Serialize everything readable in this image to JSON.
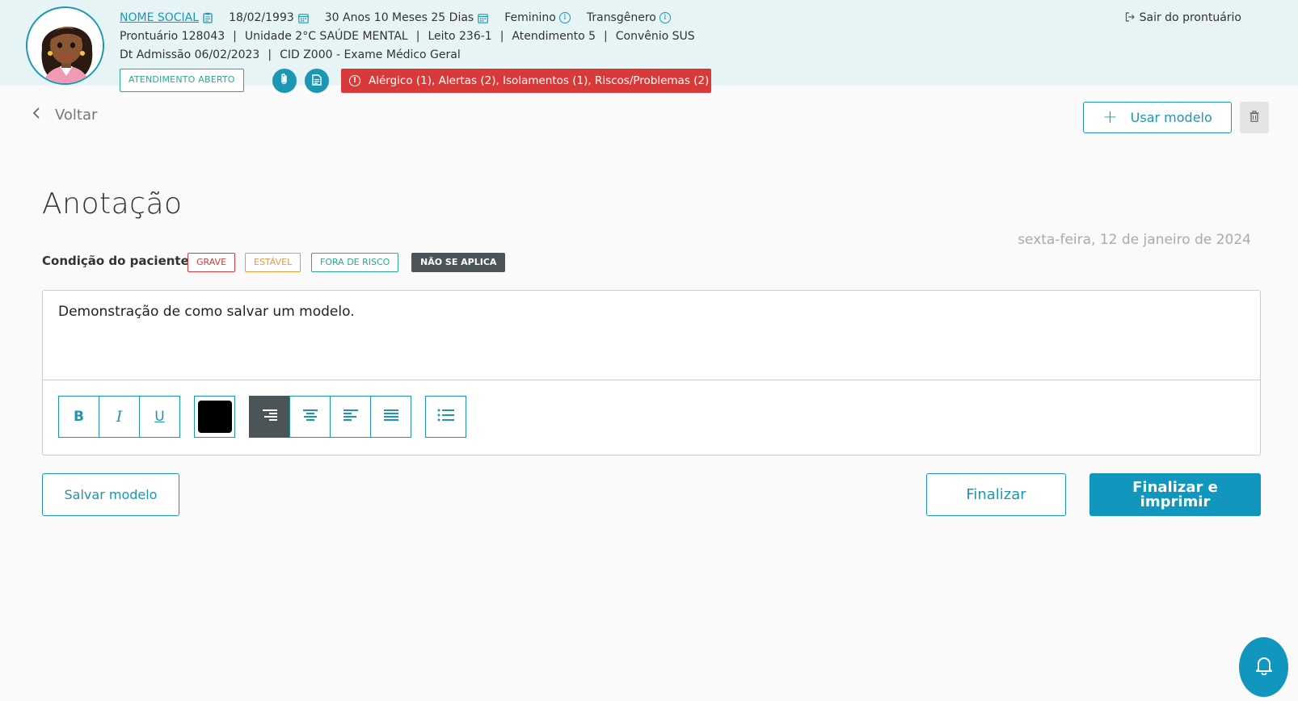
{
  "header": {
    "social_name": "NOME SOCIAL",
    "birth_date": "18/02/1993",
    "age": "30 Anos 10 Meses 25 Dias",
    "gender": "Feminino",
    "identity": "Transgênero",
    "record": "Prontuário 128043",
    "unit": "Unidade 2°C SAÚDE MENTAL",
    "bed": "Leito 236-1",
    "attendance": "Atendimento 5",
    "insurance": "Convênio SUS",
    "admission": "Dt Admissão 06/02/2023",
    "cid": "CID Z000 - Exame Médico Geral",
    "exit_label": "Sair do prontuário",
    "status_badge": "ATENDIMENTO ABERTO",
    "alerts_text": "Alérgico (1),  Alertas (2),  Isolamentos (1),  Riscos/Problemas (2)",
    "separator": "|"
  },
  "toolbar": {
    "back_label": "Voltar",
    "use_model_label": "Usar modelo"
  },
  "main": {
    "title": "Anotação",
    "date": "sexta-feira, 12 de janeiro de 2024",
    "condition_label": "Condição do paciente:",
    "conditions": [
      "GRAVE",
      "ESTÁVEL",
      "FORA DE RISCO",
      "NÃO SE APLICA"
    ],
    "editor_text": "Demonstração de como salvar um modelo."
  },
  "editor_toolbar": {
    "bold": "B",
    "italic": "I",
    "underline": "U",
    "selected_color": "#000000",
    "active_align": "align-right"
  },
  "actions": {
    "save_model": "Salvar modelo",
    "finalize": "Finalizar",
    "finalize_print": "Finalizar e imprimir"
  },
  "colors": {
    "primary": "#1b97b3",
    "primary_filled": "#1197bd",
    "danger": "#d83a3a",
    "warning": "#e89a3a",
    "success": "#2aa88a",
    "dark": "#4b5457",
    "header_bg": "#e6f4f6"
  }
}
